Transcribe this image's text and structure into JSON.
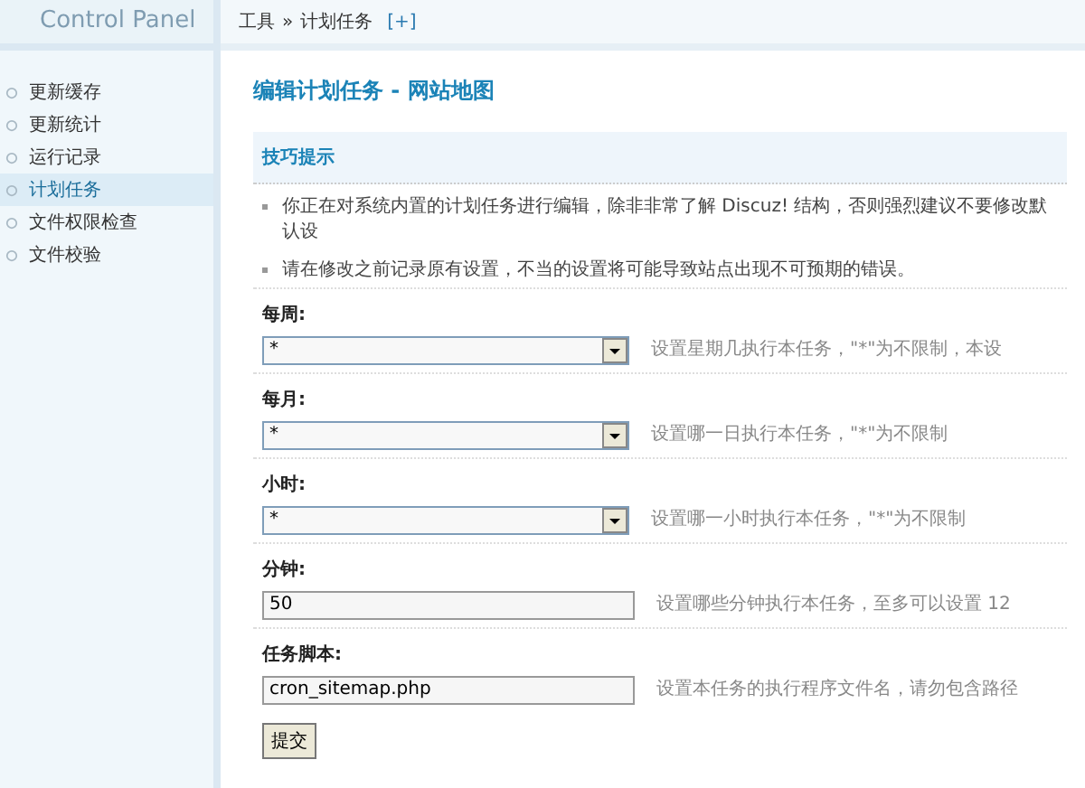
{
  "logo": {
    "text": "Control Panel"
  },
  "breadcrumb": {
    "items": [
      "工具",
      "计划任务"
    ],
    "separator": "»",
    "add_link": "[+]"
  },
  "sidebar": {
    "items": [
      {
        "label": "更新缓存",
        "selected": false
      },
      {
        "label": "更新统计",
        "selected": false
      },
      {
        "label": "运行记录",
        "selected": false
      },
      {
        "label": "计划任务",
        "selected": true
      },
      {
        "label": "文件权限检查",
        "selected": false
      },
      {
        "label": "文件校验",
        "selected": false
      }
    ]
  },
  "page_title": "编辑计划任务 - 网站地图",
  "tips": {
    "title": "技巧提示",
    "items": [
      "你正在对系统内置的计划任务进行编辑，除非非常了解 Discuz! 结构，否则强烈建议不要修改默认设",
      "请在修改之前记录原有设置，不当的设置将可能导致站点出现不可预期的错误。"
    ]
  },
  "fields": [
    {
      "kind": "select",
      "label": "每周:",
      "value": "*",
      "hint": "设置星期几执行本任务，\"*\"为不限制，本设"
    },
    {
      "kind": "select",
      "label": "每月:",
      "value": "*",
      "hint": "设置哪一日执行本任务，\"*\"为不限制"
    },
    {
      "kind": "select",
      "label": "小时:",
      "value": "*",
      "hint": "设置哪一小时执行本任务，\"*\"为不限制"
    },
    {
      "kind": "text",
      "label": "分钟:",
      "value": "50",
      "hint": "设置哪些分钟执行本任务，至多可以设置 12"
    },
    {
      "kind": "text",
      "label": "任务脚本:",
      "value": "cron_sitemap.php",
      "hint": "设置本任务的执行程序文件名，请勿包含路径"
    }
  ],
  "submit_button": "提交"
}
